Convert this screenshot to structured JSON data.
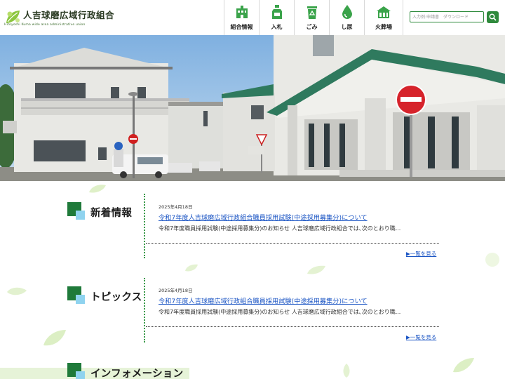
{
  "header": {
    "site_title": "人吉球磨広域行政組合",
    "site_subtitle": "Hitoyoshi Kuma wide area administrative union",
    "nav": [
      {
        "label": "組合情報",
        "icon": "building-icon"
      },
      {
        "label": "入札",
        "icon": "bottle-icon"
      },
      {
        "label": "ごみ",
        "icon": "recycle-bin-icon"
      },
      {
        "label": "し尿",
        "icon": "water-drop-icon"
      },
      {
        "label": "火葬場",
        "icon": "hall-icon"
      }
    ],
    "search": {
      "placeholder": "入力例:申請書　ダウンロード"
    }
  },
  "sections": [
    {
      "title": "新着情報",
      "date": "2025年4月18日",
      "link": "令和7年度人吉球磨広域行政組合職員採用試験(中途採用募集分)について",
      "excerpt": "令和7年度職員採用試験(中途採用募集分)のお知らせ 人吉球磨広域行政組合では､次のとおり職...",
      "more": "▶一覧を見る"
    },
    {
      "title": "トピックス",
      "date": "2025年4月18日",
      "link": "令和7年度人吉球磨広域行政組合職員採用試験(中途採用募集分)について",
      "excerpt": "令和7年度職員採用試験(中途採用募集分)のお知らせ 人吉球磨広域行政組合では､次のとおり職...",
      "more": "▶一覧を見る"
    },
    {
      "title": "インフォメーション"
    }
  ],
  "colors": {
    "brand_green": "#1f7a3a",
    "accent_blue": "#8fd3ef",
    "link": "#1b55c4"
  }
}
